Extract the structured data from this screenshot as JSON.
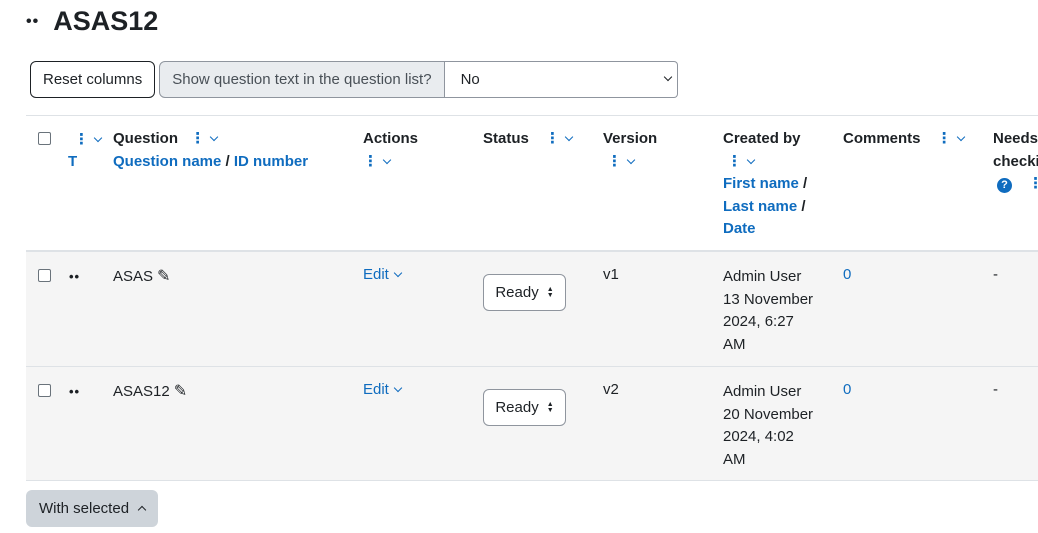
{
  "page": {
    "title": "ASAS12"
  },
  "controls": {
    "reset_label": "Reset columns",
    "show_text_label": "Show question text in the question list?",
    "show_text_value": "No"
  },
  "table": {
    "headers": {
      "type_short": "T",
      "question": "Question",
      "question_name": "Question name",
      "sep": "/",
      "id_number": "ID number",
      "actions": "Actions",
      "status": "Status",
      "version": "Version",
      "created_by": "Created by",
      "first_name": "First name",
      "last_name": "Last name",
      "date": "Date",
      "comments": "Comments",
      "needs_checking": "Needs checki"
    },
    "rows": [
      {
        "name": "ASAS",
        "action": "Edit",
        "status": "Ready",
        "version": "v1",
        "created_by": [
          "Admin User",
          "13 November",
          "2024, 6:27",
          "AM"
        ],
        "comments": "0",
        "needs_checking": "-"
      },
      {
        "name": "ASAS12",
        "action": "Edit",
        "status": "Ready",
        "version": "v2",
        "created_by": [
          "Admin User",
          "20 November",
          "2024, 4:02",
          "AM"
        ],
        "comments": "0",
        "needs_checking": "-"
      }
    ]
  },
  "footer": {
    "with_selected": "With selected"
  }
}
